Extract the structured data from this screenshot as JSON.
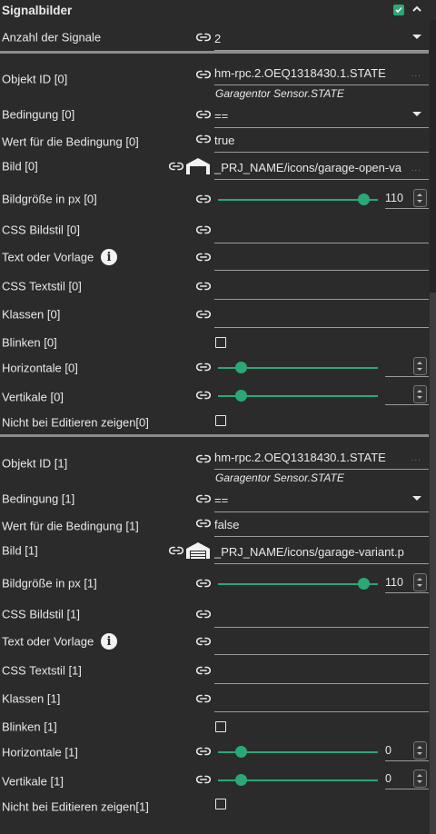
{
  "header": {
    "title": "Signalbilder"
  },
  "count": {
    "label": "Anzahl der Signale",
    "value": "2"
  },
  "signals": [
    {
      "object_id": {
        "label": "Objekt ID [0]",
        "value": "hm-rpc.2.OEQ1318430.1.STATE",
        "dots": "...",
        "sub": "Garagentor Sensor.STATE"
      },
      "condition": {
        "label": "Bedingung [0]",
        "value": "=="
      },
      "cond_value": {
        "label": "Wert für die Bedingung [0]",
        "value": "true"
      },
      "image": {
        "label": "Bild [0]",
        "value": "_PRJ_NAME/icons/garage-open-va",
        "dots": "...",
        "icon": "garage-open-icon"
      },
      "size": {
        "label": "Bildgröße in px [0]",
        "value": "110",
        "fraction": 0.91
      },
      "css_image": {
        "label": "CSS Bildstil [0]",
        "value": ""
      },
      "text": {
        "label": "Text oder Vorlage",
        "value": ""
      },
      "css_text": {
        "label": "CSS Textstil [0]",
        "value": ""
      },
      "classes": {
        "label": "Klassen [0]",
        "value": ""
      },
      "blink": {
        "label": "Blinken [0]"
      },
      "horizontal": {
        "label": "Horizontale [0]",
        "value": "",
        "fraction": 0.14
      },
      "vertical": {
        "label": "Vertikale [0]",
        "value": "",
        "fraction": 0.14
      },
      "hide_edit": {
        "label": "Nicht bei Editieren zeigen[0]"
      }
    },
    {
      "object_id": {
        "label": "Objekt ID [1]",
        "value": "hm-rpc.2.OEQ1318430.1.STATE",
        "dots": "...",
        "sub": "Garagentor Sensor.STATE"
      },
      "condition": {
        "label": "Bedingung [1]",
        "value": "=="
      },
      "cond_value": {
        "label": "Wert für die Bedingung [1]",
        "value": "false"
      },
      "image": {
        "label": "Bild [1]",
        "value": "_PRJ_NAME/icons/garage-variant.p",
        "dots": "",
        "icon": "garage-closed-icon"
      },
      "size": {
        "label": "Bildgröße in px [1]",
        "value": "110",
        "fraction": 0.91
      },
      "css_image": {
        "label": "CSS Bildstil [1]",
        "value": ""
      },
      "text": {
        "label": "Text oder Vorlage",
        "value": ""
      },
      "css_text": {
        "label": "CSS Textstil [1]",
        "value": ""
      },
      "classes": {
        "label": "Klassen [1]",
        "value": ""
      },
      "blink": {
        "label": "Blinken [1]"
      },
      "horizontal": {
        "label": "Horizontale [1]",
        "value": "0",
        "fraction": 0.14
      },
      "vertical": {
        "label": "Vertikale [1]",
        "value": "0",
        "fraction": 0.14
      },
      "hide_edit": {
        "label": "Nicht bei Editieren zeigen[1]"
      }
    }
  ],
  "colors": {
    "accent": "#2aa876",
    "background": "#2b2b2b",
    "text": "#e8e8e8"
  }
}
